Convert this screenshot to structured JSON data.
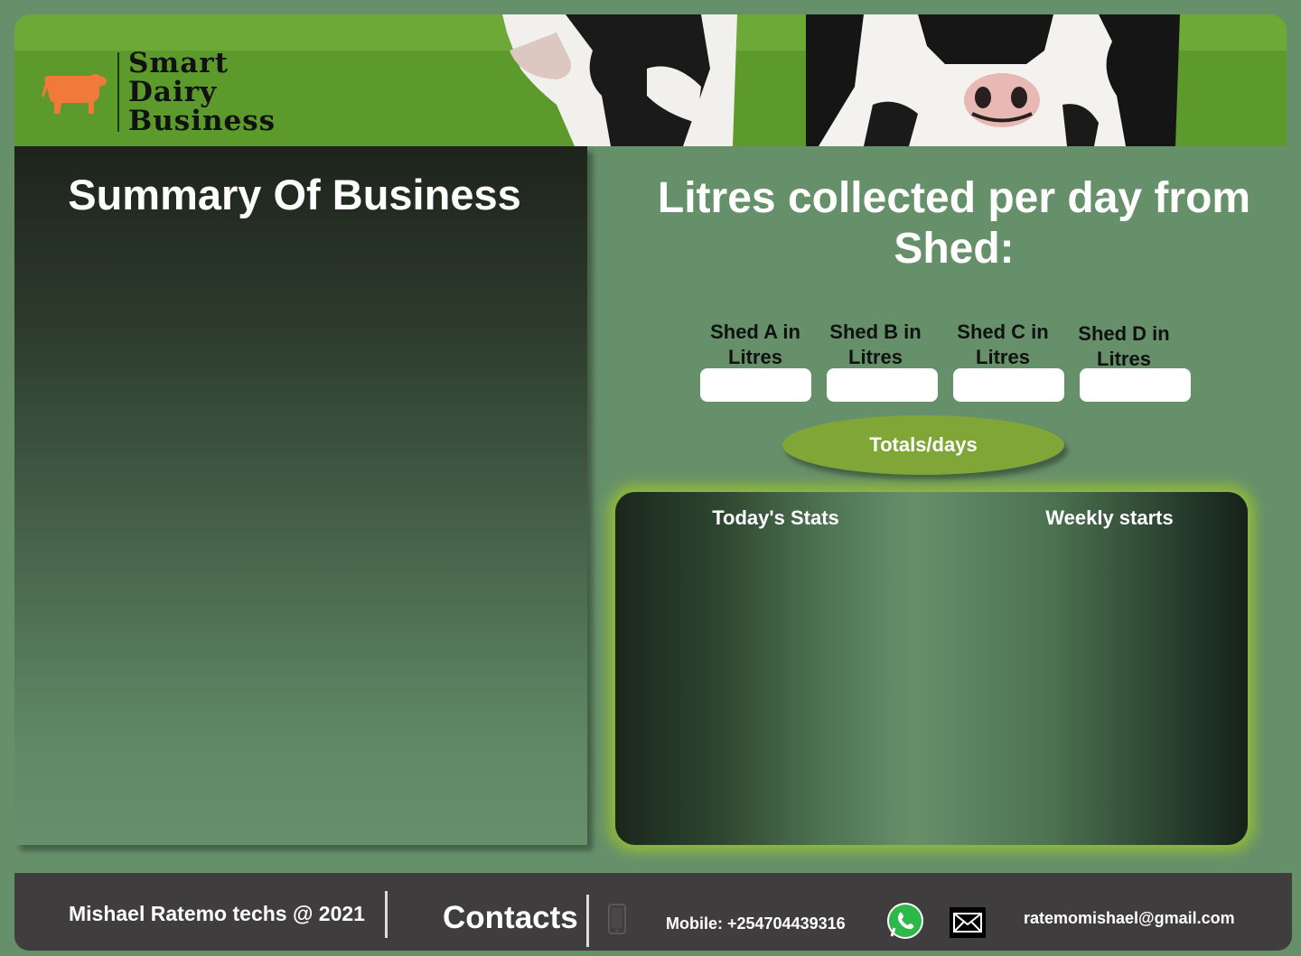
{
  "header": {
    "logo_line1": "Smart",
    "logo_line2": "Dairy",
    "logo_line3": "Business",
    "logo_icon": "cow-icon"
  },
  "summary": {
    "title": "Summary Of Business"
  },
  "collection": {
    "title": "Litres collected per day from Shed:",
    "sheds": [
      {
        "label_line1": "Shed A in",
        "label_line2": "Litres",
        "value": ""
      },
      {
        "label_line1": "Shed B  in",
        "label_line2": "Litres",
        "value": ""
      },
      {
        "label_line1": "Shed C in",
        "label_line2": "Litres",
        "value": ""
      },
      {
        "label_line1": "Shed D in",
        "label_line2": "Litres",
        "value": ""
      }
    ],
    "totals_button": "Totals/days"
  },
  "stats": {
    "today_title": "Today's Stats",
    "weekly_title": "Weekly starts"
  },
  "footer": {
    "copyright": "Mishael Ratemo techs @ 2021",
    "contacts_label": "Contacts",
    "mobile": "Mobile: +254704439316",
    "email": "ratemomishael@gmail.com",
    "icons": [
      "phone-icon",
      "whatsapp-icon",
      "mail-icon"
    ]
  },
  "colors": {
    "background": "#66906a",
    "accent_button": "#7fa637",
    "glow": "#8fb93a",
    "footer": "#403d3e",
    "logo_cow": "#f07a3a"
  }
}
